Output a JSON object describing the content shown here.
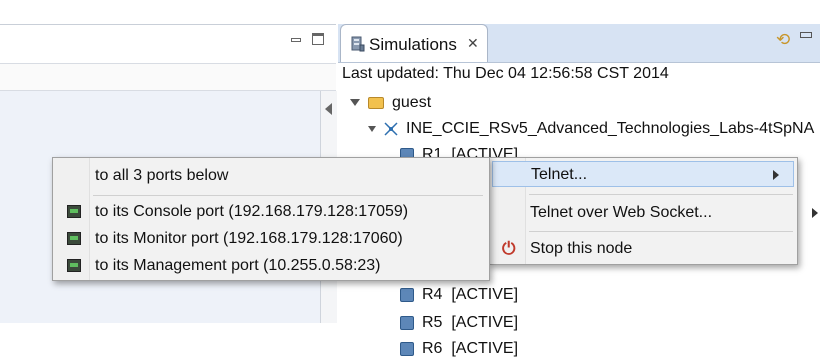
{
  "simulations_view": {
    "tab_label": "Simulations",
    "last_updated": "Last updated: Thu Dec 04 12:56:58 CST 2014",
    "tree": {
      "root": "guest",
      "topology": "INE_CCIE_RSv5_Advanced_Technologies_Labs-4tSpNA",
      "nodes": [
        {
          "name": "R1",
          "status": "[ACTIVE]"
        },
        {
          "name": "R4",
          "status": "[ACTIVE]"
        },
        {
          "name": "R5",
          "status": "[ACTIVE]"
        },
        {
          "name": "R6",
          "status": "[ACTIVE]"
        }
      ]
    }
  },
  "context_menu": {
    "items": [
      {
        "label": "Telnet..."
      },
      {
        "label": "Telnet over Web Socket..."
      },
      {
        "label": "Stop this node"
      }
    ]
  },
  "telnet_submenu": {
    "items": [
      {
        "label": "to all 3 ports below"
      },
      {
        "label": "to its Console port (192.168.179.128:17059)"
      },
      {
        "label": "to its Monitor port (192.168.179.128:17060)"
      },
      {
        "label": "to its Management port (10.255.0.58:23)"
      }
    ]
  },
  "colors": {
    "highlight": "#dbe8f8",
    "tabbar": "#d7e3f3",
    "stop_icon": "#c0392b"
  }
}
